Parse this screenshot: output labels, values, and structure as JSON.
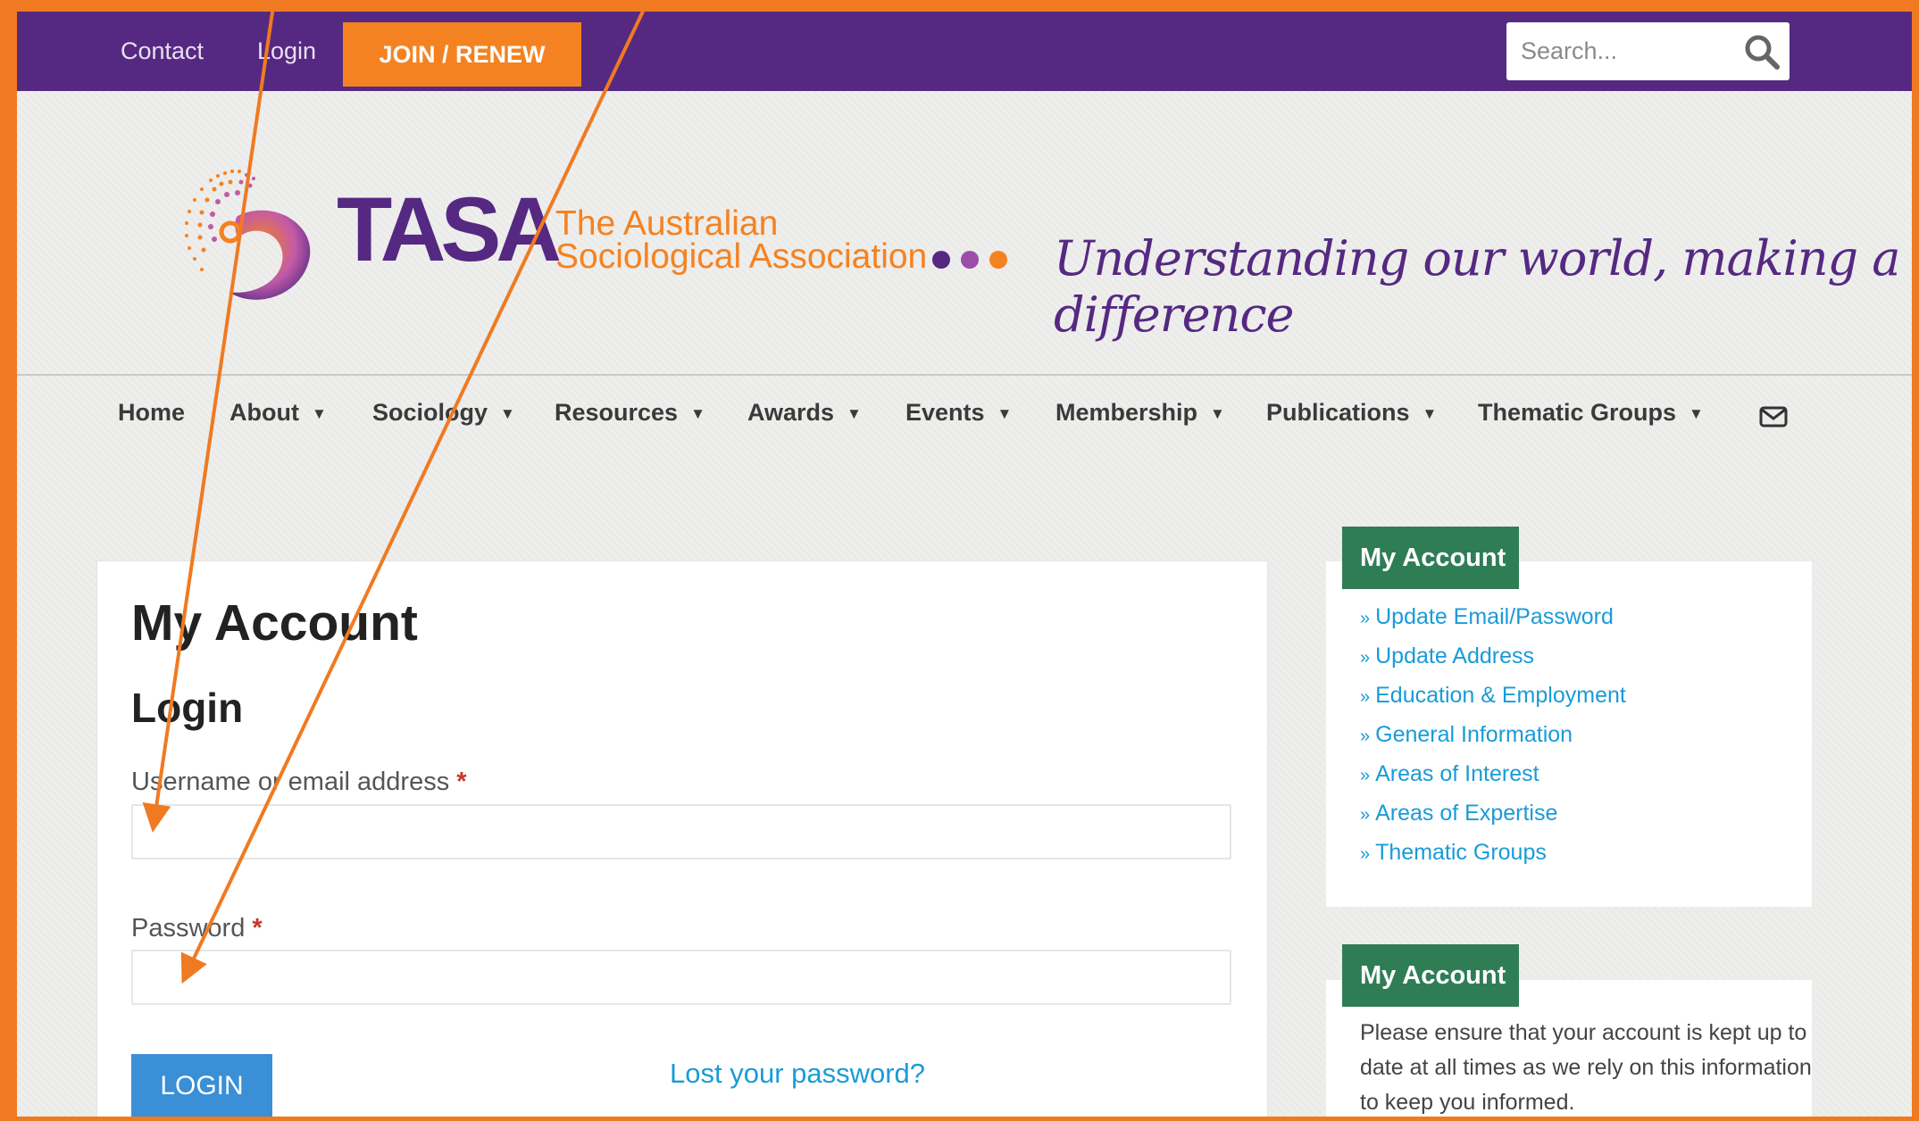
{
  "topbar": {
    "contact": "Contact",
    "login": "Login",
    "join": "JOIN / RENEW",
    "search_placeholder": "Search..."
  },
  "header": {
    "brand": "TASA",
    "assoc_line1": "The Australian",
    "assoc_line2": "Sociological Association",
    "tagline": "Understanding our world, making a difference"
  },
  "nav": {
    "items": [
      "Home",
      "About",
      "Sociology",
      "Resources",
      "Awards",
      "Events",
      "Membership",
      "Publications",
      "Thematic Groups"
    ]
  },
  "main": {
    "title": "My Account",
    "subtitle": "Login",
    "username_label": "Username or email address",
    "password_label": "Password",
    "required_mark": "*",
    "login_button": "LOGIN",
    "lost_password": "Lost your password?"
  },
  "sidebar": {
    "box1_title": "My Account",
    "links": [
      "Update Email/Password",
      "Update Address",
      "Education & Employment",
      "General Information",
      "Areas of Interest",
      "Areas of Expertise",
      "Thematic Groups"
    ],
    "link_prefix": "»",
    "box2_title": "My Account",
    "box2_text": "Please ensure that your account is kept up to date at all times as we rely on this information to keep you informed."
  },
  "colors": {
    "frame": "#f07a22",
    "topbar": "#552982",
    "accent_orange": "#f58220",
    "sidebar_head": "#2f7d55",
    "link": "#1a9bd7",
    "login_btn": "#3a8fd6",
    "annotation_arrow": "#f07a22"
  }
}
